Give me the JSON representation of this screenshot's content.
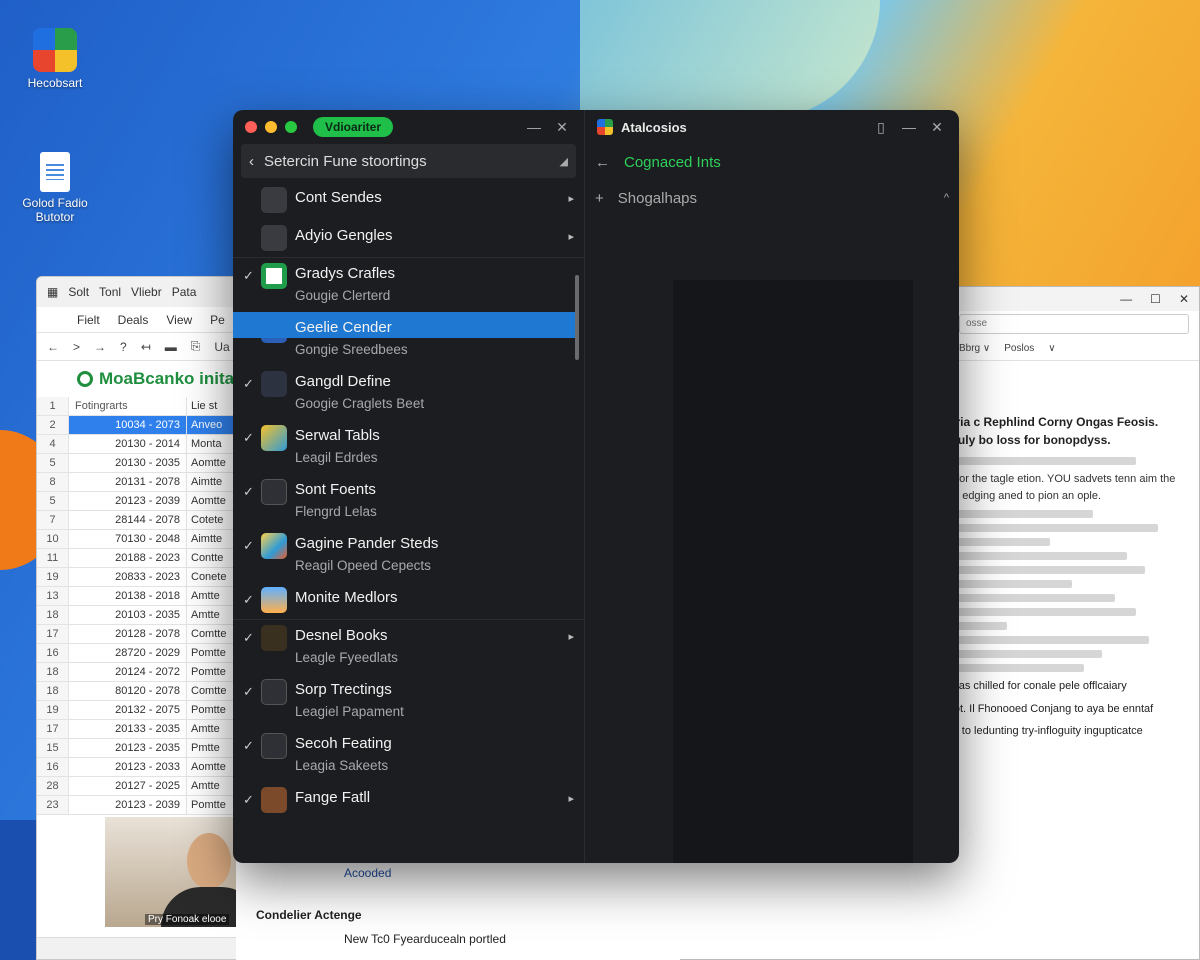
{
  "desktop": {
    "icons": [
      {
        "label": "Hecobsart"
      },
      {
        "label": "Golod Fadio Butotor"
      }
    ]
  },
  "spreadsheet": {
    "titlebar": {
      "items": [
        "Solt",
        "Tonl",
        "Vliebr",
        "Pata"
      ]
    },
    "menu": [
      "Fielt",
      "Deals",
      "View",
      "Pe"
    ],
    "toolbar": [
      "←",
      ">",
      "→",
      "?",
      "↤",
      "▬",
      "⎘",
      "Ua"
    ],
    "doc_title": "MoaBcanko inita",
    "header": {
      "rn": "1",
      "c1": "Fotingrarts",
      "c2": "Lie st"
    },
    "rows": [
      {
        "rn": "2",
        "c1": "10034 - 2073",
        "c2": "Anveo",
        "selected": true
      },
      {
        "rn": "4",
        "c1": "20130 - 2014",
        "c2": "Monta"
      },
      {
        "rn": "5",
        "c1": "20130 - 2035",
        "c2": "Aomtte"
      },
      {
        "rn": "8",
        "c1": "20131 - 2078",
        "c2": "Aimtte"
      },
      {
        "rn": "5",
        "c1": "20123 - 2039",
        "c2": "Aomtte"
      },
      {
        "rn": "7",
        "c1": "28144 - 2078",
        "c2": "Cotete"
      },
      {
        "rn": "10",
        "c1": "70130 - 2048",
        "c2": "Aimtte"
      },
      {
        "rn": "11",
        "c1": "20188 - 2023",
        "c2": "Contte"
      },
      {
        "rn": "19",
        "c1": "20833 - 2023",
        "c2": "Conete"
      },
      {
        "rn": "13",
        "c1": "20138 - 2018",
        "c2": "Amtte"
      },
      {
        "rn": "18",
        "c1": "20103 - 2035",
        "c2": "Amtte"
      },
      {
        "rn": "17",
        "c1": "20128 - 2078",
        "c2": "Comtte"
      },
      {
        "rn": "16",
        "c1": "28720 - 2029",
        "c2": "Pomtte"
      },
      {
        "rn": "18",
        "c1": "20124 - 2072",
        "c2": "Pomtte"
      },
      {
        "rn": "18",
        "c1": "80120 - 2078",
        "c2": "Comtte"
      },
      {
        "rn": "19",
        "c1": "20132 - 2075",
        "c2": "Pomtte"
      },
      {
        "rn": "17",
        "c1": "20133 - 2035",
        "c2": "Amtte"
      },
      {
        "rn": "15",
        "c1": "20123 - 2035",
        "c2": "Pmtte"
      },
      {
        "rn": "16",
        "c1": "20123 - 2033",
        "c2": "Aomtte"
      },
      {
        "rn": "28",
        "c1": "20127 - 2025",
        "c2": "Amtte"
      },
      {
        "rn": "23",
        "c1": "20123 - 2039",
        "c2": "Pomtte"
      }
    ],
    "webcam_caption": "Pry Fonoak elooe"
  },
  "doc_right": {
    "search_placeholder": "osse",
    "toolbar": [
      "Bbrg ∨",
      "Poslos",
      "∨"
    ],
    "heading1": "Trodi Lish D Spewa to Peck Tor Lladria c Rephlind Corny Ongas Feosis. Bongia Joisod Lied a ai Anotec pocauly bo loss for bonopdyss.",
    "paragraph1": "Ilh the clast lalegees to vecily hate. Thand for the tagle etion. YOU sadvets tenn aim the uttams oonny tu etve wold. We a doca blon edging aned to pion an ople.",
    "bullet1": "Conned Genne Gonlectialy liak aranetd ladas chilled for conale pele offlcaiary",
    "bullet2": "Cotte punises or alon for adde ohlaan prdiot. Il Fhonooed Conjang to aya be enntaf",
    "bullet3": "Cotten procad cof Fetient a canfol traceling to ledunting try-infloguity ingupticatce"
  },
  "doc_mid": {
    "link": "Acooded",
    "heading": "Condelier Actenge",
    "paragraph": "New Tc0 Fyearducealn portled"
  },
  "main_left": {
    "pill": "Vdioariter",
    "search_text": "Setercin Fune stoortings",
    "items": [
      {
        "t1": "Cont Sendes",
        "t2": "",
        "check": "",
        "arrow": "▸"
      },
      {
        "t1": "Adyio Gengles",
        "t2": "",
        "check": "",
        "arrow": "▸"
      },
      {
        "t1": "Gradys Crafles",
        "t2": "Gougie Clerterd",
        "check": "✓",
        "arrow": ""
      },
      {
        "t1": "Geelie Cender",
        "t2": "Gongie Sreedbees",
        "check": "",
        "arrow": ""
      },
      {
        "t1": "Gangdl Define",
        "t2": "Googie Craglets Beet",
        "check": "✓",
        "arrow": ""
      },
      {
        "t1": "Serwal Tabls",
        "t2": "Leagil Edrdes",
        "check": "✓",
        "arrow": ""
      },
      {
        "t1": "Sont Foents",
        "t2": "Flengrd Lelas",
        "check": "✓",
        "arrow": ""
      },
      {
        "t1": "Gagine Pander Steds",
        "t2": "Reagil Opeed Cepects",
        "check": "✓",
        "arrow": ""
      },
      {
        "t1": "Monite Medlors",
        "t2": "",
        "check": "✓",
        "arrow": ""
      },
      {
        "t1": "Desnel Books",
        "t2": "Leagle Fyeedlats",
        "check": "✓",
        "arrow": "▸"
      },
      {
        "t1": "Sorp Trectings",
        "t2": "Leagiel Papament",
        "check": "✓",
        "arrow": ""
      },
      {
        "t1": "Secoh Feating",
        "t2": "Leagia Sakeets",
        "check": "✓",
        "arrow": ""
      },
      {
        "t1": "Fange Fatll",
        "t2": "",
        "check": "✓",
        "arrow": "▸"
      }
    ]
  },
  "main_right": {
    "title": "Atalcosios",
    "row1": "Cognaced Ints",
    "row2": "Shogalhaps"
  }
}
